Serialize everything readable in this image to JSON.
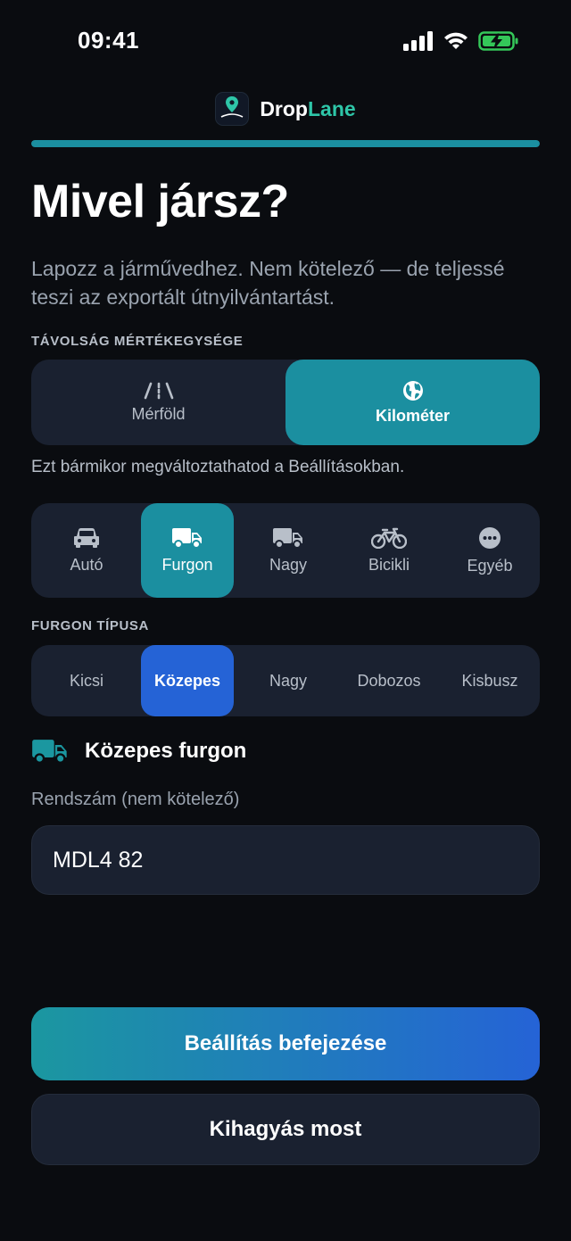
{
  "status": {
    "time": "09:41"
  },
  "brand": {
    "name_part1": "Drop",
    "name_part2": "Lane",
    "logo_text": "Drop Lane",
    "accent": "#2ec6a8"
  },
  "onboarding": {
    "progress": 1.0
  },
  "title": "Mivel jársz?",
  "subtitle": "Lapozz a járművedhez. Nem kötelező — de teljessé teszi az exportált útnyilvántartást.",
  "distance": {
    "label": "TÁVOLSÁG MÉRTÉKEGYSÉGE",
    "options": [
      {
        "label": "Mérföld",
        "icon": "road-icon",
        "selected": false
      },
      {
        "label": "Kilométer",
        "icon": "globe-icon",
        "selected": true
      }
    ],
    "hint": "Ezt bármikor megváltoztathatod a Beállításokban."
  },
  "vehicles": [
    {
      "label": "Autó",
      "icon": "car-icon",
      "selected": false
    },
    {
      "label": "Furgon",
      "icon": "van-icon",
      "selected": true
    },
    {
      "label": "Nagy",
      "icon": "truck-icon",
      "selected": false
    },
    {
      "label": "Bicikli",
      "icon": "bicycle-icon",
      "selected": false
    },
    {
      "label": "Egyéb",
      "icon": "more-icon",
      "selected": false
    }
  ],
  "van_type": {
    "label": "FURGON TÍPUSA",
    "options": [
      {
        "label": "Kicsi",
        "selected": false
      },
      {
        "label": "Közepes",
        "selected": true
      },
      {
        "label": "Nagy",
        "selected": false
      },
      {
        "label": "Dobozos",
        "selected": false
      },
      {
        "label": "Kisbusz",
        "selected": false
      }
    ]
  },
  "selected_vehicle": {
    "label": "Közepes furgon",
    "icon": "van-icon"
  },
  "plate": {
    "label": "Rendszám (nem kötelező)",
    "value": "MDL4 82"
  },
  "buttons": {
    "primary": "Beállítás befejezése",
    "secondary": "Kihagyás most"
  },
  "colors": {
    "teal": "#1b8fa0",
    "blue": "#2563d6",
    "background": "#0a0c10",
    "surface": "#1a2130"
  }
}
